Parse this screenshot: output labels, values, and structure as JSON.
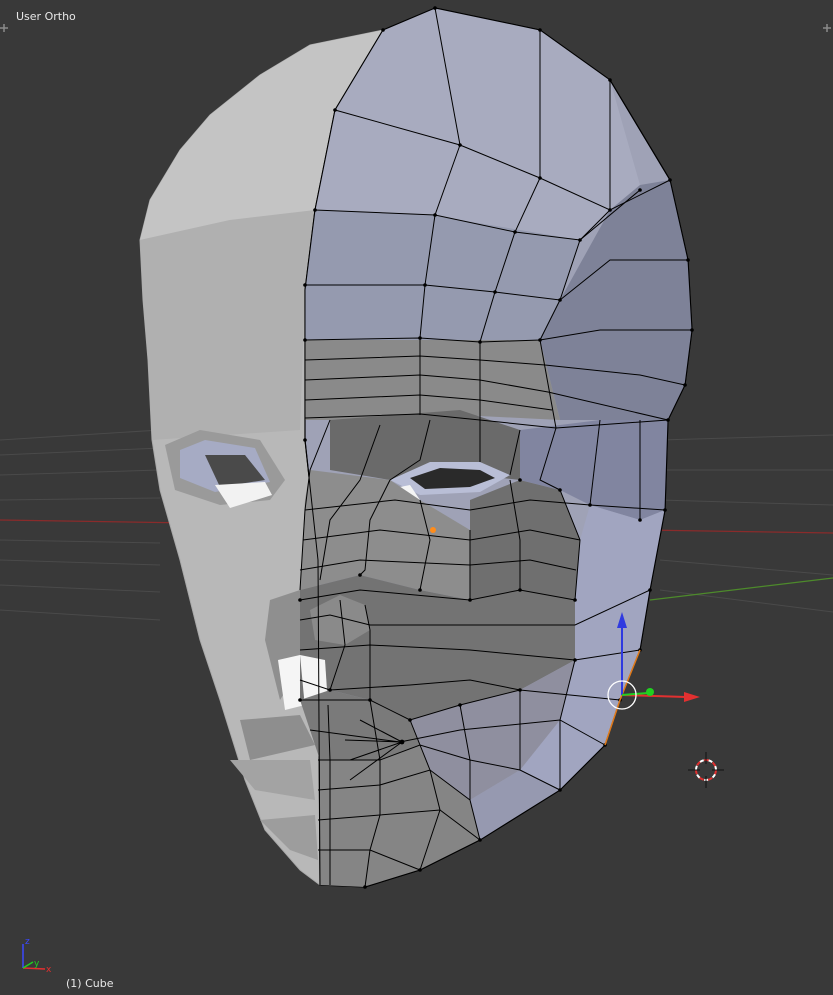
{
  "viewport": {
    "view_name": "User Ortho",
    "object_name": "(1) Cube",
    "colors": {
      "background": "#393939",
      "grid": "#4a4a4a",
      "x_axis": "#8a2b2b",
      "y_axis": "#4d8a2b",
      "mesh_light": "#b9b9b9",
      "mesh_blue": "#9ea2b8",
      "wire": "#000000",
      "selected_vertex": "#ff8c1a"
    }
  },
  "gizmo": {
    "x_arrow": "#e23030",
    "y_arrow": "#20d020",
    "z_arrow": "#2f3ae0"
  },
  "axis_widget": {
    "x": "x",
    "y": "y",
    "z": "z"
  },
  "icons": [
    "corner-plus-icon",
    "3d-cursor-icon",
    "manipulator-icon",
    "axis-orientation-icon"
  ]
}
